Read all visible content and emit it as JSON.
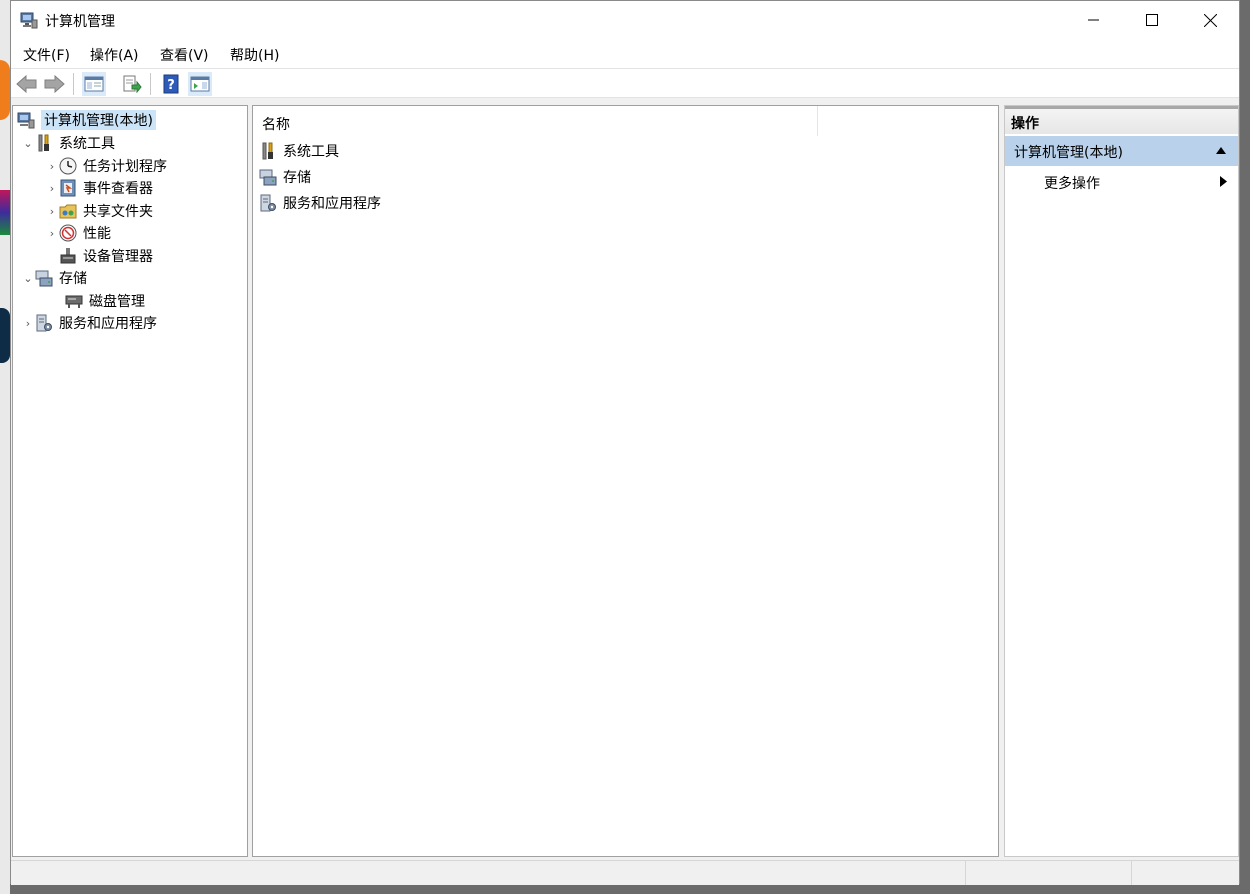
{
  "window": {
    "title": "计算机管理"
  },
  "menu": [
    {
      "label": "文件(F)"
    },
    {
      "label": "操作(A)"
    },
    {
      "label": "查看(V)"
    },
    {
      "label": "帮助(H)"
    }
  ],
  "tree": {
    "root": "计算机管理(本地)",
    "items": [
      {
        "label": "系统工具",
        "icon": "tools-icon"
      },
      {
        "label": "任务计划程序",
        "icon": "clock-icon"
      },
      {
        "label": "事件查看器",
        "icon": "event-viewer-icon"
      },
      {
        "label": "共享文件夹",
        "icon": "shared-folder-icon"
      },
      {
        "label": "性能",
        "icon": "performance-icon"
      },
      {
        "label": "设备管理器",
        "icon": "device-manager-icon"
      },
      {
        "label": "存储",
        "icon": "storage-icon"
      },
      {
        "label": "磁盘管理",
        "icon": "disk-icon"
      },
      {
        "label": "服务和应用程序",
        "icon": "services-icon"
      }
    ]
  },
  "list": {
    "column_name": "名称",
    "rows": [
      {
        "label": "系统工具"
      },
      {
        "label": "存储"
      },
      {
        "label": "服务和应用程序"
      }
    ]
  },
  "actions": {
    "header": "操作",
    "group": "计算机管理(本地)",
    "more": "更多操作"
  },
  "colors": {
    "selection": "#cce4f7",
    "action_group": "#b9d1ea"
  }
}
